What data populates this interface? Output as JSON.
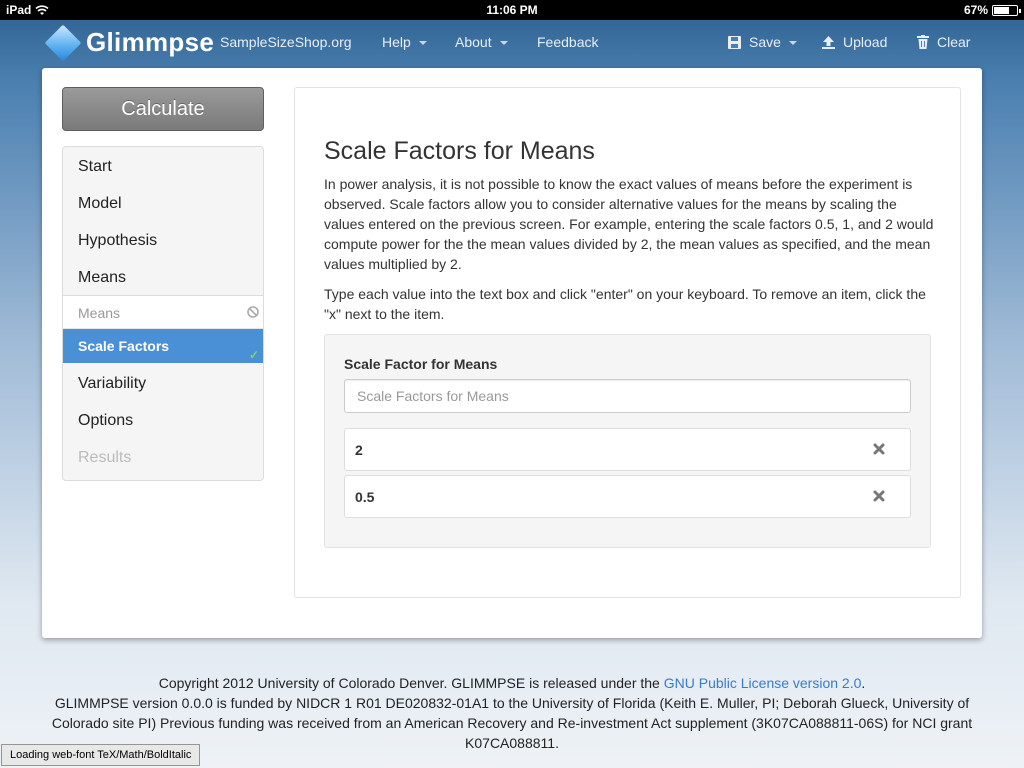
{
  "status_bar": {
    "device": "iPad",
    "time": "11:06 PM",
    "battery": "67%",
    "battery_level": 0.67
  },
  "navbar": {
    "brand": "Glimmpse",
    "links": {
      "samplesize": "SampleSizeShop.org",
      "help": "Help",
      "about": "About",
      "feedback": "Feedback",
      "save": "Save",
      "upload": "Upload",
      "clear": "Clear"
    }
  },
  "calculate_label": "Calculate",
  "sidebar": {
    "start": "Start",
    "model": "Model",
    "hypothesis": "Hypothesis",
    "means": "Means",
    "sub_means": "Means",
    "sub_scale_factors": "Scale Factors",
    "variability": "Variability",
    "options": "Options",
    "results": "Results"
  },
  "content": {
    "title": "Scale Factors for Means",
    "para1": "In power analysis, it is not possible to know the exact values of means before the experiment is observed. Scale factors allow you to consider alternative values for the means by scaling the values entered on the previous screen. For example, entering the scale factors 0.5, 1, and 2 would compute power for the the mean values divided by 2, the mean values as specified, and the mean values multiplied by 2.",
    "para2": "Type each value into the text box and click \"enter\" on your keyboard. To remove an item, click the \"x\" next to the item.",
    "field_label": "Scale Factor for Means",
    "field_placeholder": "Scale Factors for Means",
    "values": [
      "2",
      "0.5"
    ]
  },
  "footer": {
    "line1_pre": "Copyright 2012 University of Colorado Denver. GLIMMPSE is released under the ",
    "line1_link": "GNU Public License version 2.0",
    "line1_post": ".",
    "line2": "GLIMMPSE version 0.0.0 is funded by NIDCR 1 R01 DE020832-01A1 to the University of Florida (Keith E. Muller, PI; Deborah Glueck, University of Colorado site PI) Previous funding was received from an American Recovery and Re-investment Act supplement (3K07CA088811-06S) for NCI grant K07CA088811."
  },
  "loading_message": "Loading web-font TeX/Math/BoldItalic",
  "colors": {
    "active_nav": "#4a90d6",
    "link": "#3a7bc8",
    "check": "#7fd36b"
  }
}
